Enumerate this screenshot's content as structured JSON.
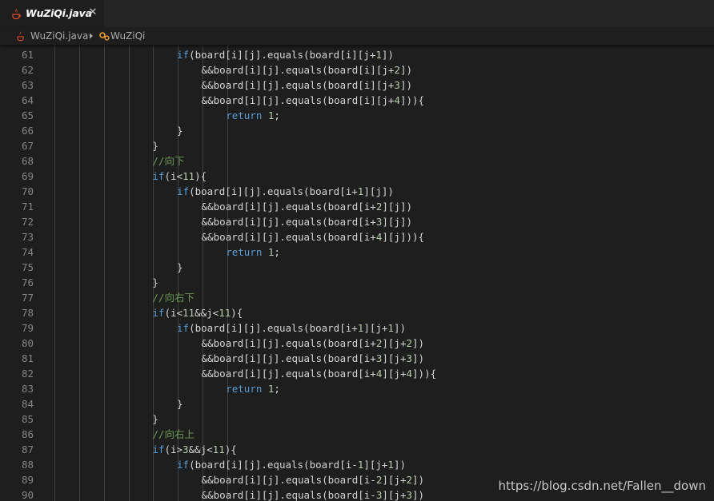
{
  "tab": {
    "title": "WuZiQi.java",
    "close_symbol": "✕",
    "icon": "java-file-icon"
  },
  "breadcrumb": {
    "file": "WuZiQi.java",
    "separator_icon": "chevron-right-icon",
    "symbol": "WuZiQi",
    "symbol_icon": "class-icon"
  },
  "colors": {
    "keyword": "#569cd6",
    "number": "#b5cea8",
    "comment": "#6a9955",
    "text": "#d4d4d4",
    "line_number": "#858585",
    "background": "#1e1e1e"
  },
  "editor": {
    "lines": [
      {
        "number": "61",
        "tokens": [
          [
            "kw",
            "if"
          ],
          [
            "t",
            "(board[i][j].equals(board[i][j+"
          ],
          [
            "n",
            "1"
          ],
          [
            "t",
            "])"
          ]
        ]
      },
      {
        "number": "62",
        "tokens": [
          [
            "t",
            "&&board[i][j].equals(board[i][j+"
          ],
          [
            "n",
            "2"
          ],
          [
            "t",
            "])"
          ]
        ]
      },
      {
        "number": "63",
        "tokens": [
          [
            "t",
            "&&board[i][j].equals(board[i][j+"
          ],
          [
            "n",
            "3"
          ],
          [
            "t",
            "])"
          ]
        ]
      },
      {
        "number": "64",
        "tokens": [
          [
            "t",
            "&&board[i][j].equals(board[i][j+"
          ],
          [
            "n",
            "4"
          ],
          [
            "t",
            "])){"
          ]
        ]
      },
      {
        "number": "65",
        "tokens": [
          [
            "kw",
            "return"
          ],
          [
            "t",
            " "
          ],
          [
            "n",
            "1"
          ],
          [
            "t",
            ";"
          ]
        ]
      },
      {
        "number": "66",
        "tokens": [
          [
            "t",
            "}"
          ]
        ]
      },
      {
        "number": "67",
        "tokens": [
          [
            "t",
            "}"
          ]
        ]
      },
      {
        "number": "68",
        "tokens": [
          [
            "c",
            "//向下"
          ]
        ]
      },
      {
        "number": "69",
        "tokens": [
          [
            "kw",
            "if"
          ],
          [
            "t",
            "(i<"
          ],
          [
            "n",
            "11"
          ],
          [
            "t",
            "){"
          ]
        ]
      },
      {
        "number": "70",
        "tokens": [
          [
            "kw",
            "if"
          ],
          [
            "t",
            "(board[i][j].equals(board[i+"
          ],
          [
            "n",
            "1"
          ],
          [
            "t",
            "][j])"
          ]
        ]
      },
      {
        "number": "71",
        "tokens": [
          [
            "t",
            "&&board[i][j].equals(board[i+"
          ],
          [
            "n",
            "2"
          ],
          [
            "t",
            "][j])"
          ]
        ]
      },
      {
        "number": "72",
        "tokens": [
          [
            "t",
            "&&board[i][j].equals(board[i+"
          ],
          [
            "n",
            "3"
          ],
          [
            "t",
            "][j])"
          ]
        ]
      },
      {
        "number": "73",
        "tokens": [
          [
            "t",
            "&&board[i][j].equals(board[i+"
          ],
          [
            "n",
            "4"
          ],
          [
            "t",
            "][j])){"
          ]
        ]
      },
      {
        "number": "74",
        "tokens": [
          [
            "kw",
            "return"
          ],
          [
            "t",
            " "
          ],
          [
            "n",
            "1"
          ],
          [
            "t",
            ";"
          ]
        ]
      },
      {
        "number": "75",
        "tokens": [
          [
            "t",
            "}"
          ]
        ]
      },
      {
        "number": "76",
        "tokens": [
          [
            "t",
            "}"
          ]
        ]
      },
      {
        "number": "77",
        "tokens": [
          [
            "c",
            "//向右下"
          ]
        ]
      },
      {
        "number": "78",
        "tokens": [
          [
            "kw",
            "if"
          ],
          [
            "t",
            "(i<"
          ],
          [
            "n",
            "11"
          ],
          [
            "t",
            "&&j<"
          ],
          [
            "n",
            "11"
          ],
          [
            "t",
            "){"
          ]
        ]
      },
      {
        "number": "79",
        "tokens": [
          [
            "kw",
            "if"
          ],
          [
            "t",
            "(board[i][j].equals(board[i+"
          ],
          [
            "n",
            "1"
          ],
          [
            "t",
            "][j+"
          ],
          [
            "n",
            "1"
          ],
          [
            "t",
            "])"
          ]
        ]
      },
      {
        "number": "80",
        "tokens": [
          [
            "t",
            "&&board[i][j].equals(board[i+"
          ],
          [
            "n",
            "2"
          ],
          [
            "t",
            "][j+"
          ],
          [
            "n",
            "2"
          ],
          [
            "t",
            "])"
          ]
        ]
      },
      {
        "number": "81",
        "tokens": [
          [
            "t",
            "&&board[i][j].equals(board[i+"
          ],
          [
            "n",
            "3"
          ],
          [
            "t",
            "][j+"
          ],
          [
            "n",
            "3"
          ],
          [
            "t",
            "])"
          ]
        ]
      },
      {
        "number": "82",
        "tokens": [
          [
            "t",
            "&&board[i][j].equals(board[i+"
          ],
          [
            "n",
            "4"
          ],
          [
            "t",
            "][j+"
          ],
          [
            "n",
            "4"
          ],
          [
            "t",
            "])){"
          ]
        ]
      },
      {
        "number": "83",
        "tokens": [
          [
            "kw",
            "return"
          ],
          [
            "t",
            " "
          ],
          [
            "n",
            "1"
          ],
          [
            "t",
            ";"
          ]
        ]
      },
      {
        "number": "84",
        "tokens": [
          [
            "t",
            "}"
          ]
        ]
      },
      {
        "number": "85",
        "tokens": [
          [
            "t",
            "}"
          ]
        ]
      },
      {
        "number": "86",
        "tokens": [
          [
            "c",
            "//向右上"
          ]
        ]
      },
      {
        "number": "87",
        "tokens": [
          [
            "kw",
            "if"
          ],
          [
            "t",
            "(i>"
          ],
          [
            "n",
            "3"
          ],
          [
            "t",
            "&&j<"
          ],
          [
            "n",
            "11"
          ],
          [
            "t",
            "){"
          ]
        ]
      },
      {
        "number": "88",
        "tokens": [
          [
            "kw",
            "if"
          ],
          [
            "t",
            "(board[i][j].equals(board[i-"
          ],
          [
            "n",
            "1"
          ],
          [
            "t",
            "][j+"
          ],
          [
            "n",
            "1"
          ],
          [
            "t",
            "])"
          ]
        ]
      },
      {
        "number": "89",
        "tokens": [
          [
            "t",
            "&&board[i][j].equals(board[i-"
          ],
          [
            "n",
            "2"
          ],
          [
            "t",
            "][j+"
          ],
          [
            "n",
            "2"
          ],
          [
            "t",
            "])"
          ]
        ]
      },
      {
        "number": "90",
        "tokens": [
          [
            "t",
            "&&board[i][j].equals(board[i-"
          ],
          [
            "n",
            "3"
          ],
          [
            "t",
            "][j+"
          ],
          [
            "n",
            "3"
          ],
          [
            "t",
            "])"
          ]
        ]
      }
    ]
  },
  "watermark": "https://blog.csdn.net/Fallen__down"
}
